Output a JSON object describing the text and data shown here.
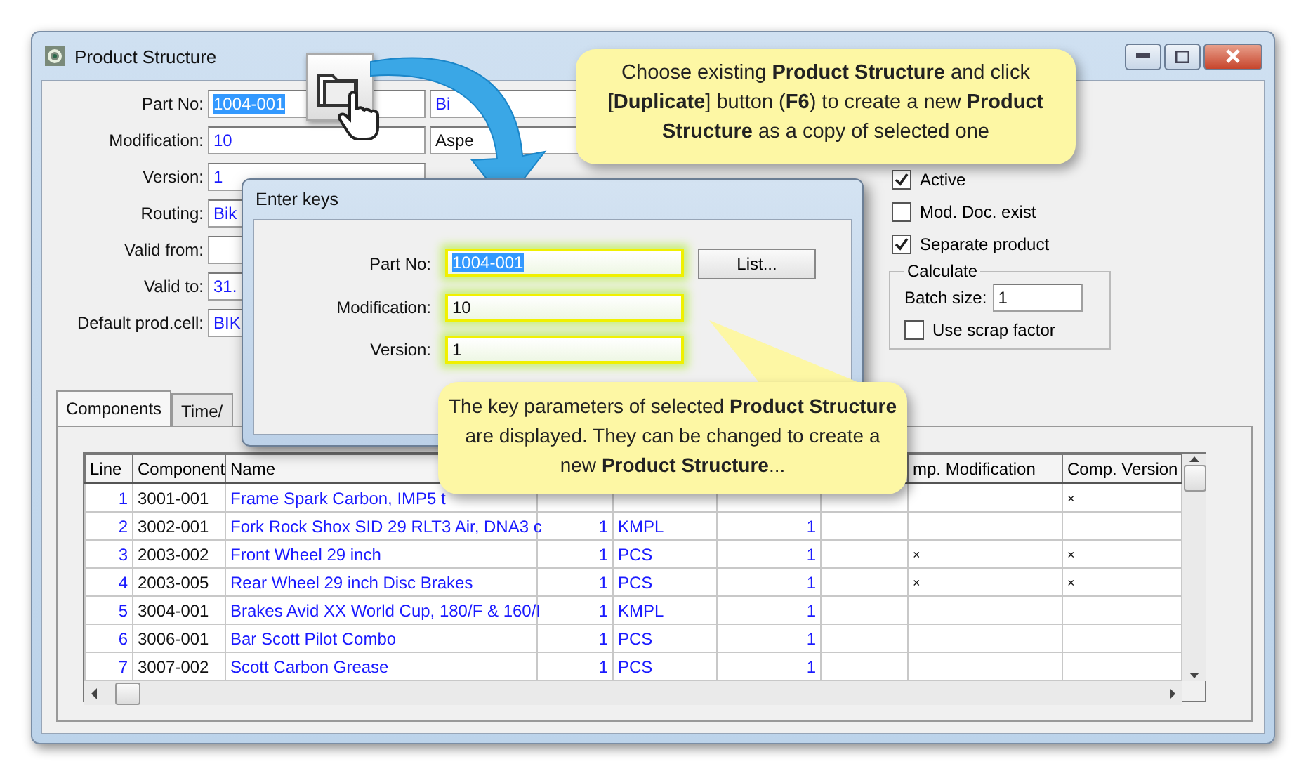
{
  "window": {
    "title": "Product Structure"
  },
  "form": {
    "left_fields": [
      {
        "label": "Part No:",
        "value": "1004-001",
        "highlighted": true
      },
      {
        "label": "Modification:",
        "value": "10",
        "highlighted": false
      },
      {
        "label": "Version:",
        "value": "1",
        "highlighted": false
      },
      {
        "label": "Routing:",
        "value": "Bik",
        "highlighted": false
      },
      {
        "label": "Valid from:"
      },
      {
        "label": "Valid to:",
        "value": "31.",
        "highlighted": false
      },
      {
        "label": "Default prod.cell:",
        "value": "BIK",
        "highlighted": false
      }
    ],
    "right_fields": [
      {
        "value": "Bi"
      },
      {
        "value": "Aspe"
      }
    ],
    "checkboxes": [
      {
        "label": "Active",
        "checked": true
      },
      {
        "label": "Mod. Doc. exist",
        "checked": false
      },
      {
        "label": "Separate product",
        "checked": true
      }
    ],
    "calculate": {
      "title": "Calculate",
      "batch_label": "Batch size:",
      "batch_value": "1",
      "scrap": {
        "label": "Use scrap factor",
        "checked": false
      }
    }
  },
  "tabs": [
    {
      "label": "Components",
      "selected": true
    },
    {
      "label": "Time/",
      "selected": false
    }
  ],
  "table": {
    "columns": [
      "Line",
      "Component",
      "Name",
      "mp. Modification",
      "Comp. Version"
    ],
    "rows": [
      {
        "line": "1",
        "component": "3001-001",
        "name": "Frame Spark Carbon, IMP5 t",
        "comp_version": "×"
      },
      {
        "line": "2",
        "component": "3002-001",
        "name": "Fork Rock Shox SID 29 RLT3 Air, DNA3 c",
        "qty": "1",
        "unit": "KMPL",
        "count": "1"
      },
      {
        "line": "3",
        "component": "2003-002",
        "name": "Front Wheel 29 inch",
        "qty": "1",
        "unit": "PCS",
        "count": "1",
        "comp_modification": "×",
        "comp_version": "×"
      },
      {
        "line": "4",
        "component": "2003-005",
        "name": "Rear Wheel 29 inch Disc Brakes",
        "qty": "1",
        "unit": "PCS",
        "count": "1",
        "comp_modification": "×",
        "comp_version": "×"
      },
      {
        "line": "5",
        "component": "3004-001",
        "name": "Brakes Avid XX World Cup, 180/F & 160/I",
        "qty": "1",
        "unit": "KMPL",
        "count": "1"
      },
      {
        "line": "6",
        "component": "3006-001",
        "name": "Bar Scott Pilot Combo",
        "qty": "1",
        "unit": "PCS",
        "count": "1"
      },
      {
        "line": "7",
        "component": "3007-002",
        "name": "Scott Carbon Grease",
        "qty": "1",
        "unit": "PCS",
        "count": "1"
      }
    ]
  },
  "dialog": {
    "title": "Enter keys",
    "fields": [
      {
        "label": "Part No:",
        "value": "1004-001",
        "highlighted": true
      },
      {
        "label": "Modification:",
        "value": "10",
        "highlighted": false
      },
      {
        "label": "Version:",
        "value": "1",
        "highlighted": false
      }
    ],
    "list_button": "List..."
  },
  "callouts": [
    {
      "text": "Choose existing **Product Structure** and click [**Duplicate**] button (**F6**) to create a new **Product Structure** as a copy of selected one"
    },
    {
      "text": "The key parameters of selected **Product Structure** are displayed.  They can be changed to create a new **Product Structure**..."
    }
  ]
}
